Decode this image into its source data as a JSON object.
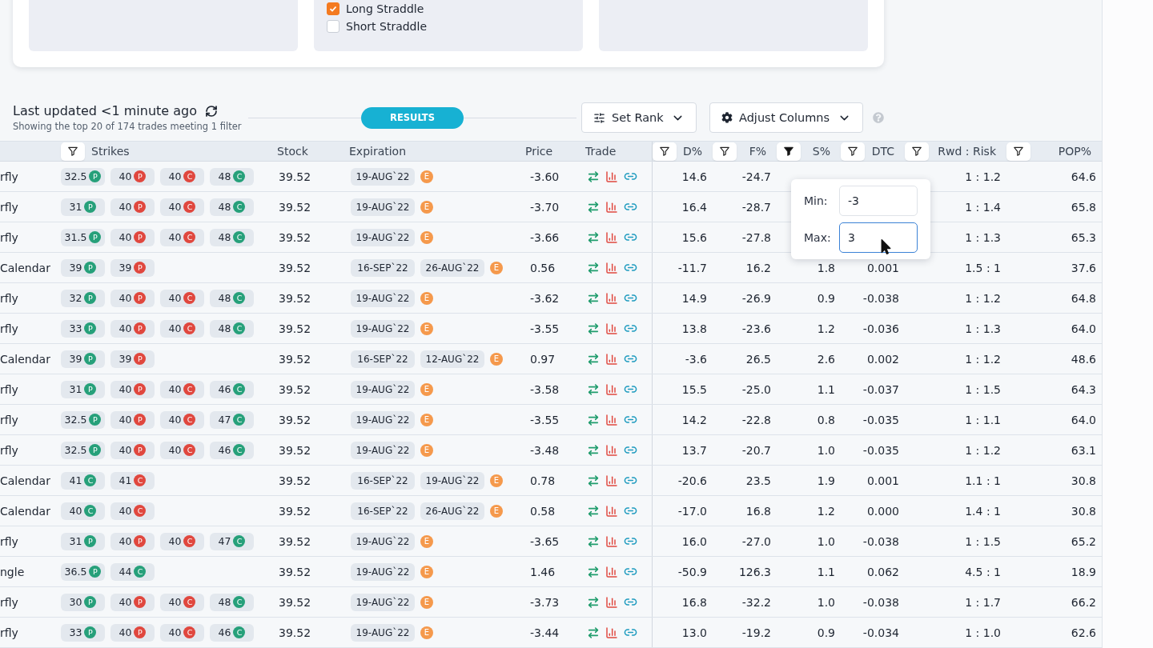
{
  "filters_panel": {
    "strategies": [
      {
        "label": "Long Straddle",
        "checked": true
      },
      {
        "label": "Short Straddle",
        "checked": false
      }
    ]
  },
  "results_bar": {
    "last_updated": "Last updated <1 minute ago",
    "summary": "Showing the top 20 of 174 trades meeting 1 filter",
    "results_label": "RESULTS",
    "set_rank": "Set Rank",
    "adjust_columns": "Adjust Columns"
  },
  "columns": [
    {
      "kind": "strikes",
      "label": "Strikes",
      "filter": true,
      "filter_active": false
    },
    {
      "kind": "stock",
      "label": "Stock"
    },
    {
      "kind": "expiration",
      "label": "Expiration"
    },
    {
      "kind": "price",
      "label": "Price"
    },
    {
      "kind": "trade",
      "label": "Trade"
    },
    {
      "kind": "metric",
      "label": "D%",
      "filter": true,
      "filter_active": false
    },
    {
      "kind": "metric",
      "label": "F%",
      "filter": true,
      "filter_active": false
    },
    {
      "kind": "metric",
      "label": "S%",
      "filter": true,
      "filter_active": true
    },
    {
      "kind": "metric",
      "label": "DTC",
      "filter": true,
      "filter_active": false
    },
    {
      "kind": "metric",
      "label": "Rwd : Risk",
      "filter": true,
      "filter_active": false
    },
    {
      "kind": "metric",
      "label": "POP%",
      "filter": true,
      "filter_active": false
    }
  ],
  "rows": [
    {
      "strategy": "rfly",
      "strikes": [
        {
          "v": "32.5",
          "side": "P",
          "color": "#26a07a"
        },
        {
          "v": "40",
          "side": "P",
          "color": "#e0473e"
        },
        {
          "v": "40",
          "side": "C",
          "color": "#e0473e"
        },
        {
          "v": "48",
          "side": "C",
          "color": "#26a07a"
        }
      ],
      "stock": "39.52",
      "expirations": [
        "19-AUG`22"
      ],
      "earnings": "E",
      "price": "-3.60",
      "d": "14.6",
      "f": "-24.7",
      "rwd": "1 : 1.2",
      "pop": "64.6"
    },
    {
      "strategy": "rfly",
      "strikes": [
        {
          "v": "31",
          "side": "P",
          "color": "#26a07a"
        },
        {
          "v": "40",
          "side": "P",
          "color": "#e0473e"
        },
        {
          "v": "40",
          "side": "C",
          "color": "#e0473e"
        },
        {
          "v": "48",
          "side": "C",
          "color": "#26a07a"
        }
      ],
      "stock": "39.52",
      "expirations": [
        "19-AUG`22"
      ],
      "earnings": "E",
      "price": "-3.70",
      "d": "16.4",
      "f": "-28.7",
      "rwd": "1 : 1.4",
      "pop": "65.8"
    },
    {
      "strategy": "rfly",
      "strikes": [
        {
          "v": "31.5",
          "side": "P",
          "color": "#26a07a"
        },
        {
          "v": "40",
          "side": "P",
          "color": "#e0473e"
        },
        {
          "v": "40",
          "side": "C",
          "color": "#e0473e"
        },
        {
          "v": "48",
          "side": "C",
          "color": "#26a07a"
        }
      ],
      "stock": "39.52",
      "expirations": [
        "19-AUG`22"
      ],
      "earnings": "E",
      "price": "-3.66",
      "d": "15.6",
      "f": "-27.8",
      "rwd": "1 : 1.3",
      "pop": "65.3"
    },
    {
      "strategy": "Calendar",
      "strikes": [
        {
          "v": "39",
          "side": "P",
          "color": "#26a07a"
        },
        {
          "v": "39",
          "side": "P",
          "color": "#e0473e"
        }
      ],
      "stock": "39.52",
      "expirations": [
        "16-SEP`22",
        "26-AUG`22"
      ],
      "earnings": "E",
      "price": "0.56",
      "d": "-11.7",
      "f": "16.2",
      "s": "1.8",
      "dtc": "0.001",
      "rwd": "1.5 : 1",
      "pop": "37.6"
    },
    {
      "strategy": "rfly",
      "strikes": [
        {
          "v": "32",
          "side": "P",
          "color": "#26a07a"
        },
        {
          "v": "40",
          "side": "P",
          "color": "#e0473e"
        },
        {
          "v": "40",
          "side": "C",
          "color": "#e0473e"
        },
        {
          "v": "48",
          "side": "C",
          "color": "#26a07a"
        }
      ],
      "stock": "39.52",
      "expirations": [
        "19-AUG`22"
      ],
      "earnings": "E",
      "price": "-3.62",
      "d": "14.9",
      "f": "-26.9",
      "s": "0.9",
      "dtc": "-0.038",
      "rwd": "1 : 1.2",
      "pop": "64.8"
    },
    {
      "strategy": "rfly",
      "strikes": [
        {
          "v": "33",
          "side": "P",
          "color": "#26a07a"
        },
        {
          "v": "40",
          "side": "P",
          "color": "#e0473e"
        },
        {
          "v": "40",
          "side": "C",
          "color": "#e0473e"
        },
        {
          "v": "48",
          "side": "C",
          "color": "#26a07a"
        }
      ],
      "stock": "39.52",
      "expirations": [
        "19-AUG`22"
      ],
      "earnings": "E",
      "price": "-3.55",
      "d": "13.8",
      "f": "-23.6",
      "s": "1.2",
      "dtc": "-0.036",
      "rwd": "1 : 1.3",
      "pop": "64.0"
    },
    {
      "strategy": "Calendar",
      "strikes": [
        {
          "v": "39",
          "side": "P",
          "color": "#26a07a"
        },
        {
          "v": "39",
          "side": "P",
          "color": "#e0473e"
        }
      ],
      "stock": "39.52",
      "expirations": [
        "16-SEP`22",
        "12-AUG`22"
      ],
      "earnings": "E",
      "price": "0.97",
      "d": "-3.6",
      "f": "26.5",
      "s": "2.6",
      "dtc": "0.002",
      "rwd": "1 : 1.2",
      "pop": "48.6"
    },
    {
      "strategy": "rfly",
      "strikes": [
        {
          "v": "31",
          "side": "P",
          "color": "#26a07a"
        },
        {
          "v": "40",
          "side": "P",
          "color": "#e0473e"
        },
        {
          "v": "40",
          "side": "C",
          "color": "#e0473e"
        },
        {
          "v": "46",
          "side": "C",
          "color": "#26a07a"
        }
      ],
      "stock": "39.52",
      "expirations": [
        "19-AUG`22"
      ],
      "earnings": "E",
      "price": "-3.58",
      "d": "15.5",
      "f": "-25.0",
      "s": "1.1",
      "dtc": "-0.037",
      "rwd": "1 : 1.5",
      "pop": "64.3"
    },
    {
      "strategy": "rfly",
      "strikes": [
        {
          "v": "32.5",
          "side": "P",
          "color": "#26a07a"
        },
        {
          "v": "40",
          "side": "P",
          "color": "#e0473e"
        },
        {
          "v": "40",
          "side": "C",
          "color": "#e0473e"
        },
        {
          "v": "47",
          "side": "C",
          "color": "#26a07a"
        }
      ],
      "stock": "39.52",
      "expirations": [
        "19-AUG`22"
      ],
      "earnings": "E",
      "price": "-3.55",
      "d": "14.2",
      "f": "-22.8",
      "s": "0.8",
      "dtc": "-0.035",
      "rwd": "1 : 1.1",
      "pop": "64.0"
    },
    {
      "strategy": "rfly",
      "strikes": [
        {
          "v": "32.5",
          "side": "P",
          "color": "#26a07a"
        },
        {
          "v": "40",
          "side": "P",
          "color": "#e0473e"
        },
        {
          "v": "40",
          "side": "C",
          "color": "#e0473e"
        },
        {
          "v": "46",
          "side": "C",
          "color": "#26a07a"
        }
      ],
      "stock": "39.52",
      "expirations": [
        "19-AUG`22"
      ],
      "earnings": "E",
      "price": "-3.48",
      "d": "13.7",
      "f": "-20.7",
      "s": "1.0",
      "dtc": "-0.035",
      "rwd": "1 : 1.2",
      "pop": "63.1"
    },
    {
      "strategy": "Calendar",
      "strikes": [
        {
          "v": "41",
          "side": "C",
          "color": "#26a07a"
        },
        {
          "v": "41",
          "side": "C",
          "color": "#e0473e"
        }
      ],
      "stock": "39.52",
      "expirations": [
        "16-SEP`22",
        "19-AUG`22"
      ],
      "earnings": "E",
      "price": "0.78",
      "d": "-20.6",
      "f": "23.5",
      "s": "1.9",
      "dtc": "0.001",
      "rwd": "1.1 : 1",
      "pop": "30.8"
    },
    {
      "strategy": "Calendar",
      "strikes": [
        {
          "v": "40",
          "side": "C",
          "color": "#26a07a"
        },
        {
          "v": "40",
          "side": "C",
          "color": "#e0473e"
        }
      ],
      "stock": "39.52",
      "expirations": [
        "16-SEP`22",
        "26-AUG`22"
      ],
      "earnings": "E",
      "price": "0.58",
      "d": "-17.0",
      "f": "16.8",
      "s": "1.2",
      "dtc": "0.000",
      "rwd": "1.4 : 1",
      "pop": "30.8"
    },
    {
      "strategy": "rfly",
      "strikes": [
        {
          "v": "31",
          "side": "P",
          "color": "#26a07a"
        },
        {
          "v": "40",
          "side": "P",
          "color": "#e0473e"
        },
        {
          "v": "40",
          "side": "C",
          "color": "#e0473e"
        },
        {
          "v": "47",
          "side": "C",
          "color": "#26a07a"
        }
      ],
      "stock": "39.52",
      "expirations": [
        "19-AUG`22"
      ],
      "earnings": "E",
      "price": "-3.65",
      "d": "16.0",
      "f": "-27.0",
      "s": "1.0",
      "dtc": "-0.038",
      "rwd": "1 : 1.5",
      "pop": "65.2"
    },
    {
      "strategy": "ngle",
      "strikes": [
        {
          "v": "36.5",
          "side": "P",
          "color": "#26a07a"
        },
        {
          "v": "44",
          "side": "C",
          "color": "#26a07a"
        }
      ],
      "stock": "39.52",
      "expirations": [
        "19-AUG`22"
      ],
      "earnings": "E",
      "price": "1.46",
      "d": "-50.9",
      "f": "126.3",
      "s": "1.1",
      "dtc": "0.062",
      "rwd": "4.5 : 1",
      "pop": "18.9"
    },
    {
      "strategy": "rfly",
      "strikes": [
        {
          "v": "30",
          "side": "P",
          "color": "#26a07a"
        },
        {
          "v": "40",
          "side": "P",
          "color": "#e0473e"
        },
        {
          "v": "40",
          "side": "C",
          "color": "#e0473e"
        },
        {
          "v": "48",
          "side": "C",
          "color": "#26a07a"
        }
      ],
      "stock": "39.52",
      "expirations": [
        "19-AUG`22"
      ],
      "earnings": "E",
      "price": "-3.73",
      "d": "16.8",
      "f": "-32.2",
      "s": "1.0",
      "dtc": "-0.038",
      "rwd": "1 : 1.7",
      "pop": "66.2"
    },
    {
      "strategy": "rfly",
      "strikes": [
        {
          "v": "33",
          "side": "P",
          "color": "#26a07a"
        },
        {
          "v": "40",
          "side": "P",
          "color": "#e0473e"
        },
        {
          "v": "40",
          "side": "C",
          "color": "#e0473e"
        },
        {
          "v": "46",
          "side": "C",
          "color": "#26a07a"
        }
      ],
      "stock": "39.52",
      "expirations": [
        "19-AUG`22"
      ],
      "earnings": "E",
      "price": "-3.44",
      "d": "13.0",
      "f": "-19.2",
      "s": "0.9",
      "dtc": "-0.034",
      "rwd": "1 : 1.0",
      "pop": "62.6"
    }
  ],
  "range_filter": {
    "fields": [
      {
        "label": "Min:",
        "value": "-3",
        "focused": false
      },
      {
        "label": "Max:",
        "value": "3",
        "focused": true
      }
    ]
  }
}
